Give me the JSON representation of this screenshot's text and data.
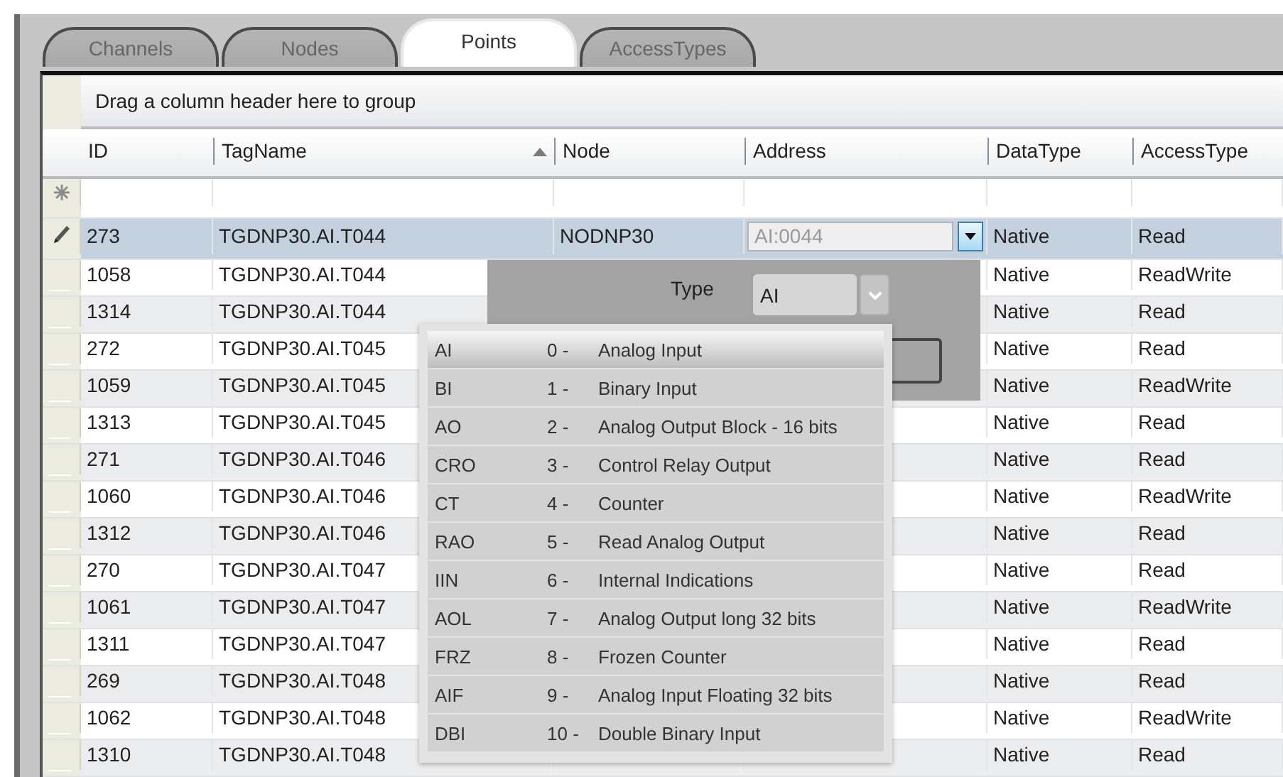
{
  "tabs": [
    {
      "label": "Channels",
      "selected": false
    },
    {
      "label": "Nodes",
      "selected": false
    },
    {
      "label": "Points",
      "selected": true
    },
    {
      "label": "AccessTypes",
      "selected": false
    }
  ],
  "table": {
    "group_hint": "Drag a column header here to group",
    "columns": [
      {
        "label": "ID",
        "sorted": false
      },
      {
        "label": "TagName",
        "sorted": true
      },
      {
        "label": "Node",
        "sorted": false
      },
      {
        "label": "Address",
        "sorted": false
      },
      {
        "label": "DataType",
        "sorted": false
      },
      {
        "label": "AccessType",
        "sorted": false
      }
    ],
    "rows": [
      {
        "id": "273",
        "tag_name": "TGDNP30.AI.T044",
        "node": "NODNP30",
        "address": {
          "value": "AI:0044",
          "disabled": true
        },
        "data_type": "Native",
        "access_type": "Read",
        "selected": true,
        "editing": true
      },
      {
        "id": "1058",
        "tag_name": "TGDNP30.AI.T044",
        "data_type": "Native",
        "access_type": "ReadWrite",
        "selected": false,
        "editing": false
      },
      {
        "id": "1314",
        "tag_name": "TGDNP30.AI.T044",
        "data_type": "Native",
        "access_type": "Read",
        "selected": false,
        "editing": false
      },
      {
        "id": "272",
        "tag_name": "TGDNP30.AI.T045",
        "data_type": "Native",
        "access_type": "Read",
        "selected": false,
        "editing": false
      },
      {
        "id": "1059",
        "tag_name": "TGDNP30.AI.T045",
        "data_type": "Native",
        "access_type": "ReadWrite",
        "selected": false,
        "editing": false
      },
      {
        "id": "1313",
        "tag_name": "TGDNP30.AI.T045",
        "data_type": "Native",
        "access_type": "Read",
        "selected": false,
        "editing": false
      },
      {
        "id": "271",
        "tag_name": "TGDNP30.AI.T046",
        "data_type": "Native",
        "access_type": "Read",
        "selected": false,
        "editing": false
      },
      {
        "id": "1060",
        "tag_name": "TGDNP30.AI.T046",
        "data_type": "Native",
        "access_type": "ReadWrite",
        "selected": false,
        "editing": false
      },
      {
        "id": "1312",
        "tag_name": "TGDNP30.AI.T046",
        "data_type": "Native",
        "access_type": "Read",
        "selected": false,
        "editing": false
      },
      {
        "id": "270",
        "tag_name": "TGDNP30.AI.T047",
        "data_type": "Native",
        "access_type": "Read",
        "selected": false,
        "editing": false
      },
      {
        "id": "1061",
        "tag_name": "TGDNP30.AI.T047",
        "data_type": "Native",
        "access_type": "ReadWrite",
        "selected": false,
        "editing": false
      },
      {
        "id": "1311",
        "tag_name": "TGDNP30.AI.T047",
        "data_type": "Native",
        "access_type": "Read",
        "selected": false,
        "editing": false
      },
      {
        "id": "269",
        "tag_name": "TGDNP30.AI.T048",
        "data_type": "Native",
        "access_type": "Read",
        "selected": false,
        "editing": false
      },
      {
        "id": "1062",
        "tag_name": "TGDNP30.AI.T048",
        "data_type": "Native",
        "access_type": "ReadWrite",
        "selected": false,
        "editing": false
      },
      {
        "id": "1310",
        "tag_name": "TGDNP30.AI.T048",
        "data_type": "Native",
        "access_type": "Read",
        "selected": false,
        "editing": false
      }
    ]
  },
  "type_popup": {
    "label": "Type",
    "value": "AI",
    "options": [
      {
        "code": "AI",
        "number": "0 -",
        "name": "Analog Input",
        "selected": true
      },
      {
        "code": "BI",
        "number": "1 -",
        "name": "Binary Input",
        "selected": false
      },
      {
        "code": "AO",
        "number": "2 -",
        "name": "Analog Output Block - 16 bits",
        "selected": false
      },
      {
        "code": "CRO",
        "number": "3 -",
        "name": "Control Relay Output",
        "selected": false
      },
      {
        "code": "CT",
        "number": "4 -",
        "name": "Counter",
        "selected": false
      },
      {
        "code": "RAO",
        "number": "5 -",
        "name": "Read Analog Output",
        "selected": false
      },
      {
        "code": "IIN",
        "number": "6 -",
        "name": "Internal Indications",
        "selected": false
      },
      {
        "code": "AOL",
        "number": "7 -",
        "name": "Analog Output long 32 bits",
        "selected": false
      },
      {
        "code": "FRZ",
        "number": "8 -",
        "name": "Frozen Counter",
        "selected": false
      },
      {
        "code": "AIF",
        "number": "9 -",
        "name": "Analog Input Floating 32 bits",
        "selected": false
      },
      {
        "code": "DBI",
        "number": "10 -",
        "name": "Double Binary Input",
        "selected": false
      }
    ]
  }
}
